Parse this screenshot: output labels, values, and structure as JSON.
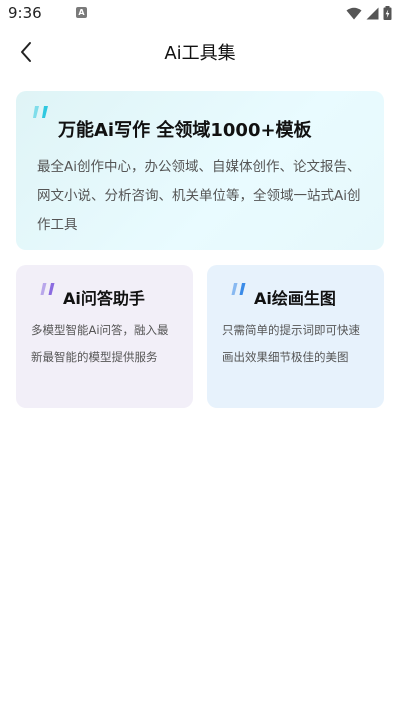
{
  "status_bar": {
    "time": "9:36",
    "app_icon_letter": "A"
  },
  "header": {
    "title": "Ai工具集"
  },
  "main_card": {
    "title": "万能Ai写作 全领域1000+模板",
    "description": "最全Ai创作中心，办公领域、自媒体创作、论文报告、网文小说、分析咨询、机关单位等，全领域一站式Ai创作工具",
    "quote_color": "#2fc8e0"
  },
  "qa_card": {
    "title": "Ai问答助手",
    "description": "多模型智能Ai问答，融入最新最智能的模型提供服务",
    "quote_color": "#8b6be0"
  },
  "draw_card": {
    "title": "Ai绘画生图",
    "description": "只需简单的提示词即可快速画出效果细节极佳的美图",
    "quote_color": "#3a8be8"
  }
}
